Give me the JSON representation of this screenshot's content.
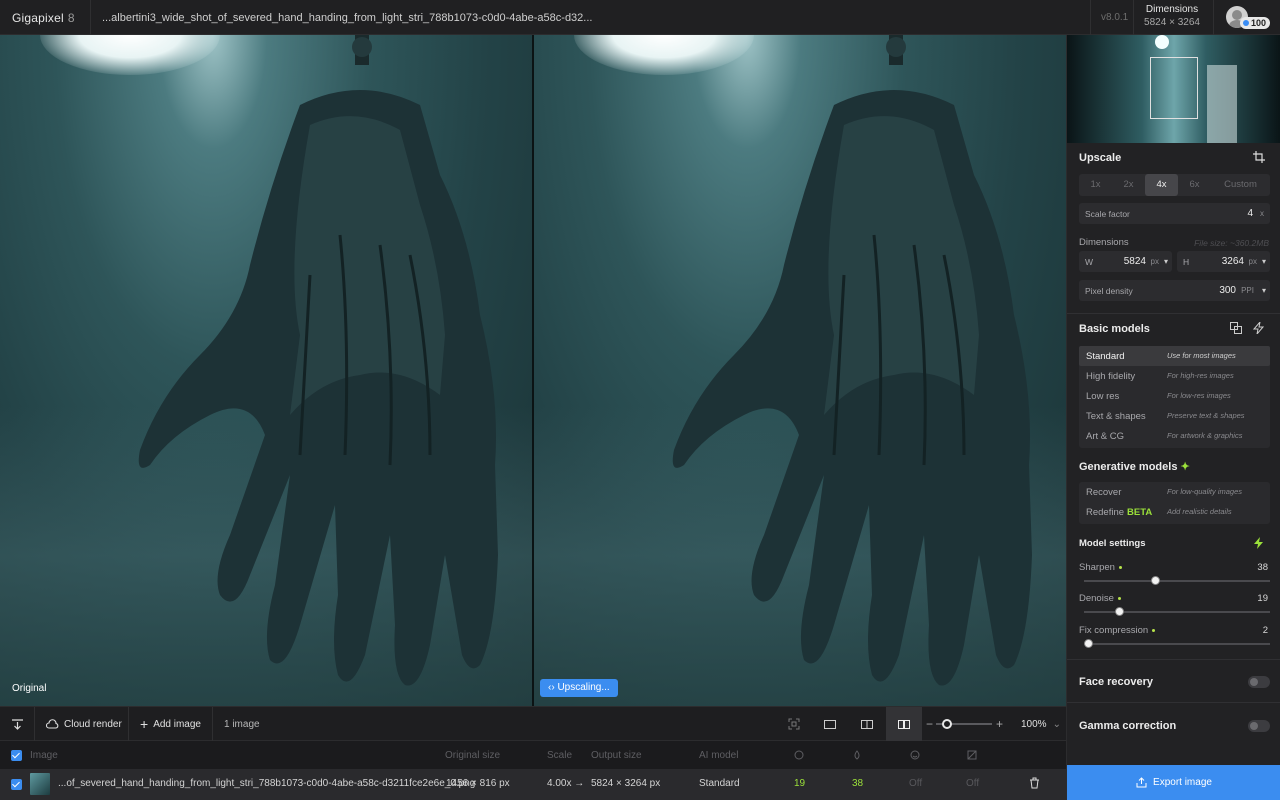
{
  "app": {
    "name": "Gigapixel",
    "version_major": "8",
    "version": "v8.0.1"
  },
  "file": {
    "name": "...albertini3_wide_shot_of_severed_hand_handing_from_light_stri_788b1073-c0d0-4abe-a58c-d32..."
  },
  "header": {
    "dimensions_label": "Dimensions",
    "dimensions_value": "5824 × 3264",
    "credits": "100"
  },
  "viewer": {
    "original_label": "Original",
    "upscaling_label": "Upscaling..."
  },
  "toolbar": {
    "cloud_render": "Cloud render",
    "add_image": "Add image",
    "image_count": "1 image",
    "zoom": "100%",
    "zoom_level": 0.2
  },
  "table": {
    "headers": {
      "image": "Image",
      "original_size": "Original size",
      "scale": "Scale",
      "output_size": "Output size",
      "ai_model": "AI model"
    },
    "rows": [
      {
        "name": "...of_severed_hand_handing_from_light_stri_788b1073-c0d0-4abe-a58c-d3211fce2e6e_0.png",
        "original_size": "1456 × 816 px",
        "scale": "4.00x →",
        "output_size": "5824 × 3264 px",
        "ai_model": "Standard",
        "denoise": "19",
        "sharpen": "38",
        "face": "Off",
        "gamma": "Off"
      }
    ]
  },
  "panel": {
    "upscale_title": "Upscale",
    "scale_options": [
      "1x",
      "2x",
      "4x",
      "6x",
      "Custom"
    ],
    "scale_selected": "4x",
    "scale_factor_label": "Scale factor",
    "scale_factor_value": "4",
    "scale_factor_unit": "x",
    "dimensions_label": "Dimensions",
    "file_size_hint": "File size: ~360.2MB",
    "w_label": "W",
    "w_value": "5824",
    "w_unit": "px",
    "h_label": "H",
    "h_value": "3264",
    "h_unit": "px",
    "pixel_density_label": "Pixel density",
    "pixel_density_value": "300",
    "pixel_density_unit": "PPI",
    "basic_models_title": "Basic models",
    "basic_models": [
      {
        "name": "Standard",
        "desc": "Use for most images"
      },
      {
        "name": "High fidelity",
        "desc": "For high-res images"
      },
      {
        "name": "Low res",
        "desc": "For low-res images"
      },
      {
        "name": "Text & shapes",
        "desc": "Preserve text & shapes"
      },
      {
        "name": "Art & CG",
        "desc": "For artwork & graphics"
      }
    ],
    "generative_models_title": "Generative models",
    "generative_models": [
      {
        "name": "Recover",
        "desc": "For low-quality images"
      },
      {
        "name": "Redefine",
        "badge": "BETA",
        "desc": "Add realistic details"
      }
    ],
    "model_settings_title": "Model settings",
    "sliders": [
      {
        "label": "Sharpen",
        "value": "38",
        "level": 0.38
      },
      {
        "label": "Denoise",
        "value": "19",
        "level": 0.19
      },
      {
        "label": "Fix compression",
        "value": "2",
        "level": 0.02
      }
    ],
    "face_recovery": "Face recovery",
    "gamma_correction": "Gamma correction",
    "export": "Export image"
  },
  "colors": {
    "accent": "#3b8df0",
    "highlight": "#9be03a"
  }
}
